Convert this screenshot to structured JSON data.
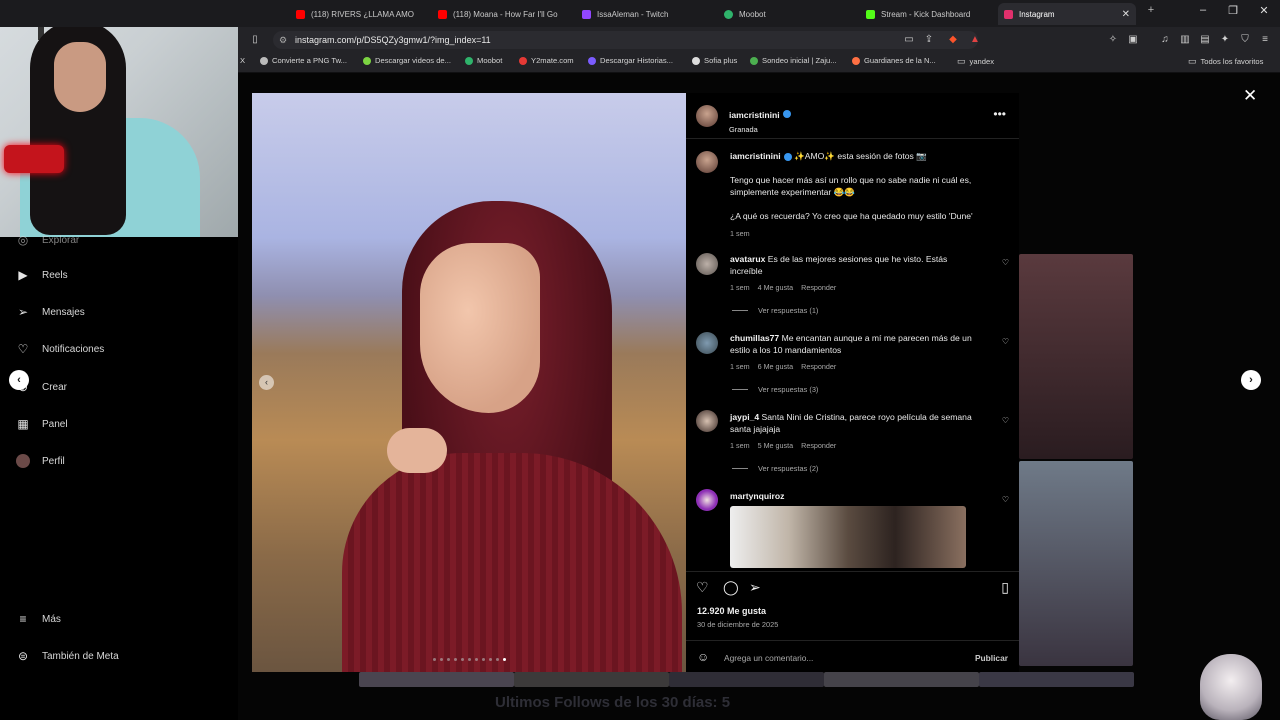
{
  "browser": {
    "tabs": [
      {
        "label": "(118) RIVERS ¿LLAMA AMO",
        "color": "#ff0000"
      },
      {
        "label": "(118) Moana - How Far I'll Go",
        "color": "#ff0000"
      },
      {
        "label": "IssaAleman - Twitch",
        "color": "#9146ff"
      },
      {
        "label": "Moobot",
        "color": "#2fb36b"
      },
      {
        "label": "Stream - Kick Dashboard",
        "color": "#53fc18"
      },
      {
        "label": "Instagram",
        "color": "#e1306c"
      }
    ],
    "url": "instagram.com/p/DS5QZy3gmw1/?img_index=11",
    "bookmarks": [
      {
        "label": "X"
      },
      {
        "label": "Convierte a PNG Tw..."
      },
      {
        "label": "Descargar videos de..."
      },
      {
        "label": "Moobot"
      },
      {
        "label": "Y2mate.com"
      },
      {
        "label": "Descargar Historias..."
      },
      {
        "label": "Sofia plus"
      },
      {
        "label": "Sondeo inicial | Zaju..."
      },
      {
        "label": "Guardianes de la N..."
      },
      {
        "label": "yandex"
      },
      {
        "label": "Todos los favoritos"
      }
    ]
  },
  "sidenav": {
    "items": [
      {
        "label": "Explorar",
        "icon": "compass-icon"
      },
      {
        "label": "Reels",
        "icon": "reels-icon"
      },
      {
        "label": "Mensajes",
        "icon": "messenger-icon"
      },
      {
        "label": "Notificaciones",
        "icon": "heart-icon"
      },
      {
        "label": "Crear",
        "icon": "plus-icon"
      },
      {
        "label": "Panel",
        "icon": "chart-icon"
      },
      {
        "label": "Perfil",
        "icon": "avatar-icon"
      },
      {
        "label": "Más",
        "icon": "menu-icon"
      },
      {
        "label": "También de Meta",
        "icon": "meta-icon"
      }
    ]
  },
  "post": {
    "author": "iamcristinini",
    "location": "Granada",
    "caption_line1": "✨AMO✨ esta sesión de fotos 📷",
    "caption_line2": "Tengo que hacer más así un rollo que no sabe nadie ni cuál es,",
    "caption_line3": "simplemente experimentar 😂😂",
    "caption_line4": "¿A qué os recuerda? Yo creo que ha quedado muy estilo 'Dune'",
    "caption_time": "1 sem",
    "likes": "12.920 Me gusta",
    "date": "30 de diciembre de 2025",
    "comment_placeholder": "Agrega un comentario...",
    "publish": "Publicar",
    "carousel_total": 11,
    "carousel_index": 11
  },
  "comments": [
    {
      "user": "avatarux",
      "text1": "Es de las mejores sesiones que he visto. Estás",
      "text2": "increíble",
      "time": "1 sem",
      "likes": "4 Me gusta",
      "reply": "Responder",
      "replies": "Ver respuestas (1)"
    },
    {
      "user": "chumillas77",
      "text1": "Me encantan aunque a mí me parecen más de un",
      "text2": "estilo a los 10 mandamientos",
      "time": "1 sem",
      "likes": "6 Me gusta",
      "reply": "Responder",
      "replies": "Ver respuestas (3)"
    },
    {
      "user": "jaypi_4",
      "text1": "Santa Nini de Cristina, parece royo película de semana",
      "text2": "santa jajajaja",
      "time": "1 sem",
      "likes": "5 Me gusta",
      "reply": "Responder",
      "replies": "Ver respuestas (2)"
    },
    {
      "user": "martynquiroz"
    }
  ],
  "overlay_text": "Ultimos Follows de los 30 días: 5"
}
